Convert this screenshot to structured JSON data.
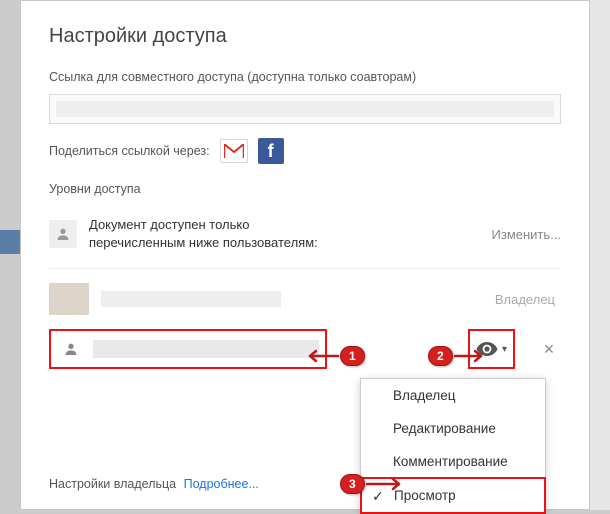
{
  "dialog": {
    "title": "Настройки доступа",
    "link_section_label": "Ссылка для совместного доступа (доступна только соавторам)",
    "share_via_label": "Поделиться ссылкой через:",
    "access_levels_label": "Уровни доступа",
    "restricted_text_line1": "Документ доступен только",
    "restricted_text_line2": "перечисленным ниже пользователям:",
    "change_link": "Изменить...",
    "owner_label": "Владелец",
    "footer_text": "Настройки владельца",
    "footer_more": "Подробнее..."
  },
  "dropdown": {
    "items": [
      {
        "label": "Владелец",
        "selected": false
      },
      {
        "label": "Редактирование",
        "selected": false
      },
      {
        "label": "Комментирование",
        "selected": false
      },
      {
        "label": "Просмотр",
        "selected": true
      }
    ]
  },
  "callouts": {
    "c1": "1",
    "c2": "2",
    "c3": "3"
  },
  "icons": {
    "gmail": "gmail-icon",
    "facebook": "f",
    "person": "person-icon",
    "eye": "eye-icon",
    "caret": "▾",
    "close": "×",
    "check": "✓"
  }
}
